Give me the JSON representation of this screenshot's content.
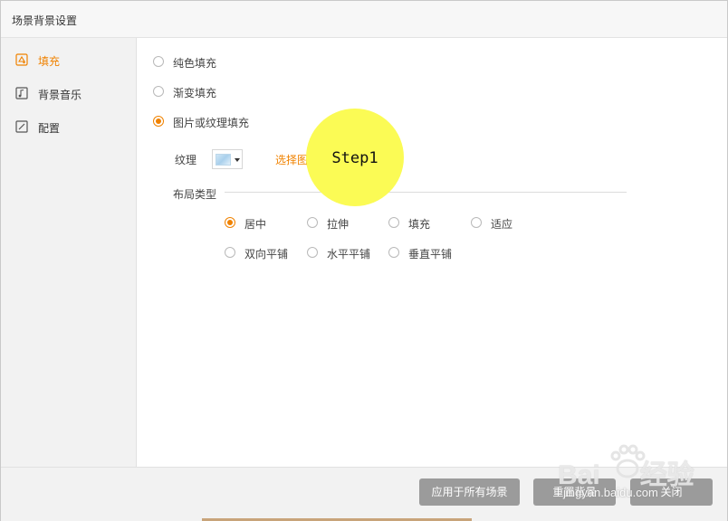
{
  "window": {
    "title": "场景背景设置"
  },
  "sidebar": {
    "items": [
      {
        "label": "填充",
        "icon": "fill-icon",
        "active": true
      },
      {
        "label": "背景音乐",
        "icon": "music-icon",
        "active": false
      },
      {
        "label": "配置",
        "icon": "config-icon",
        "active": false
      }
    ]
  },
  "fill": {
    "options": [
      {
        "label": "纯色填充",
        "selected": false
      },
      {
        "label": "渐变填充",
        "selected": false
      },
      {
        "label": "图片或纹理填充",
        "selected": true
      }
    ],
    "texture_label": "纹理",
    "choose_image_label": "选择图片",
    "layout_label": "布局类型",
    "layout_options": [
      {
        "label": "居中",
        "selected": true
      },
      {
        "label": "拉伸",
        "selected": false
      },
      {
        "label": "填充",
        "selected": false
      },
      {
        "label": "适应",
        "selected": false
      },
      {
        "label": "双向平铺",
        "selected": false
      },
      {
        "label": "水平平铺",
        "selected": false
      },
      {
        "label": "垂直平铺",
        "selected": false
      }
    ]
  },
  "footer": {
    "apply_all_label": "应用于所有场景",
    "reset_label": "重置背景",
    "close_label": "关闭"
  },
  "annotation": {
    "step_label": "Step1",
    "highlight_color": "#fbfb55"
  },
  "watermark": {
    "brand": "Bai",
    "brand_suffix": "经验",
    "url": "jingyan.baidu.com"
  },
  "colors": {
    "accent": "#f08200",
    "button": "#9b9b9b",
    "sidebar_bg": "#f2f2f2"
  }
}
